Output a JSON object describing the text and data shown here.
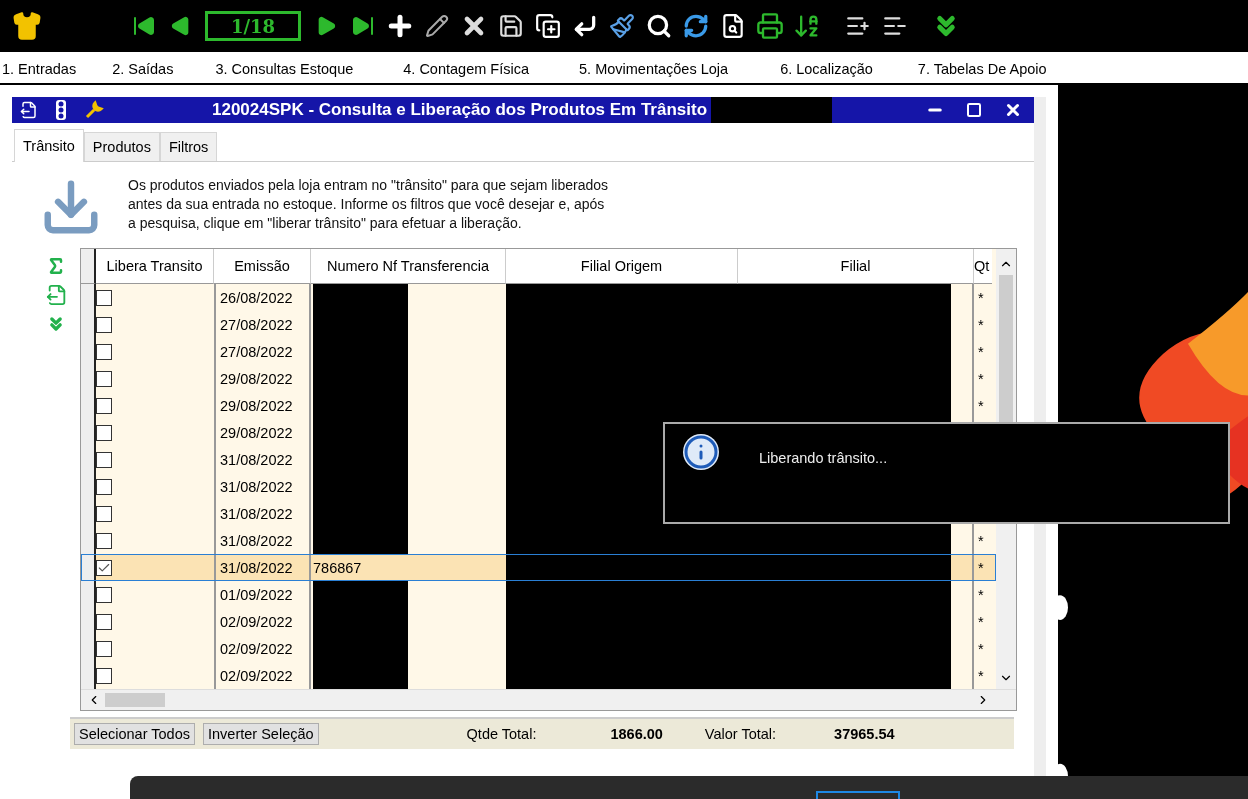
{
  "toolbar": {
    "page_counter": "1/18"
  },
  "menu": [
    "1. Entradas",
    "2. Saídas",
    "3. Consultas Estoque",
    "4. Contagem Física",
    "5. Movimentações Loja",
    "6. Localização",
    "7. Tabelas De Apoio"
  ],
  "window": {
    "title": "120024SPK - Consulta e Liberação dos Produtos Em Trânsito"
  },
  "tabs": [
    {
      "label": "Trânsito",
      "selected": true
    },
    {
      "label": "Produtos",
      "selected": false
    },
    {
      "label": "Filtros",
      "selected": false
    }
  ],
  "description": [
    "Os produtos enviados pela loja entram no \"trânsito\" para que sejam liberados",
    "antes da sua entrada no estoque. Informe os filtros que você desejar e, após",
    "a pesquisa, clique em \"liberar trânsito\" para efetuar a liberação."
  ],
  "table": {
    "columns": [
      "Libera Transito",
      "Emissão",
      "Numero Nf Transferencia",
      "Filial Origem",
      "Filial",
      "Qt"
    ],
    "rows": [
      {
        "checked": false,
        "selected": false,
        "date": "26/08/2022",
        "qt": "*"
      },
      {
        "checked": false,
        "selected": false,
        "date": "27/08/2022",
        "qt": "*"
      },
      {
        "checked": false,
        "selected": false,
        "date": "27/08/2022",
        "qt": "*"
      },
      {
        "checked": false,
        "selected": false,
        "date": "29/08/2022",
        "qt": "*"
      },
      {
        "checked": false,
        "selected": false,
        "date": "29/08/2022",
        "qt": "*"
      },
      {
        "checked": false,
        "selected": false,
        "date": "29/08/2022"
      },
      {
        "checked": false,
        "selected": false,
        "date": "31/08/2022"
      },
      {
        "checked": false,
        "selected": false,
        "date": "31/08/2022"
      },
      {
        "checked": false,
        "selected": false,
        "date": "31/08/2022"
      },
      {
        "checked": false,
        "selected": false,
        "date": "31/08/2022",
        "qt": "*"
      },
      {
        "checked": true,
        "selected": true,
        "date": "31/08/2022",
        "nf": "786867",
        "qt": "*"
      },
      {
        "checked": false,
        "selected": false,
        "date": "01/09/2022",
        "qt": "*"
      },
      {
        "checked": false,
        "selected": false,
        "date": "02/09/2022",
        "qt": "*"
      },
      {
        "checked": false,
        "selected": false,
        "date": "02/09/2022",
        "qt": "*"
      },
      {
        "checked": false,
        "selected": false,
        "date": "02/09/2022",
        "qt": "*"
      }
    ]
  },
  "buttons": [
    "Selecionar Todos",
    "Inverter Seleção"
  ],
  "totals": [
    {
      "label": "Qtde Total:",
      "value": "1866.00"
    },
    {
      "label": "Valor Total:",
      "value": "37965.54"
    }
  ],
  "popup": {
    "message": "Liberando trânsito..."
  }
}
